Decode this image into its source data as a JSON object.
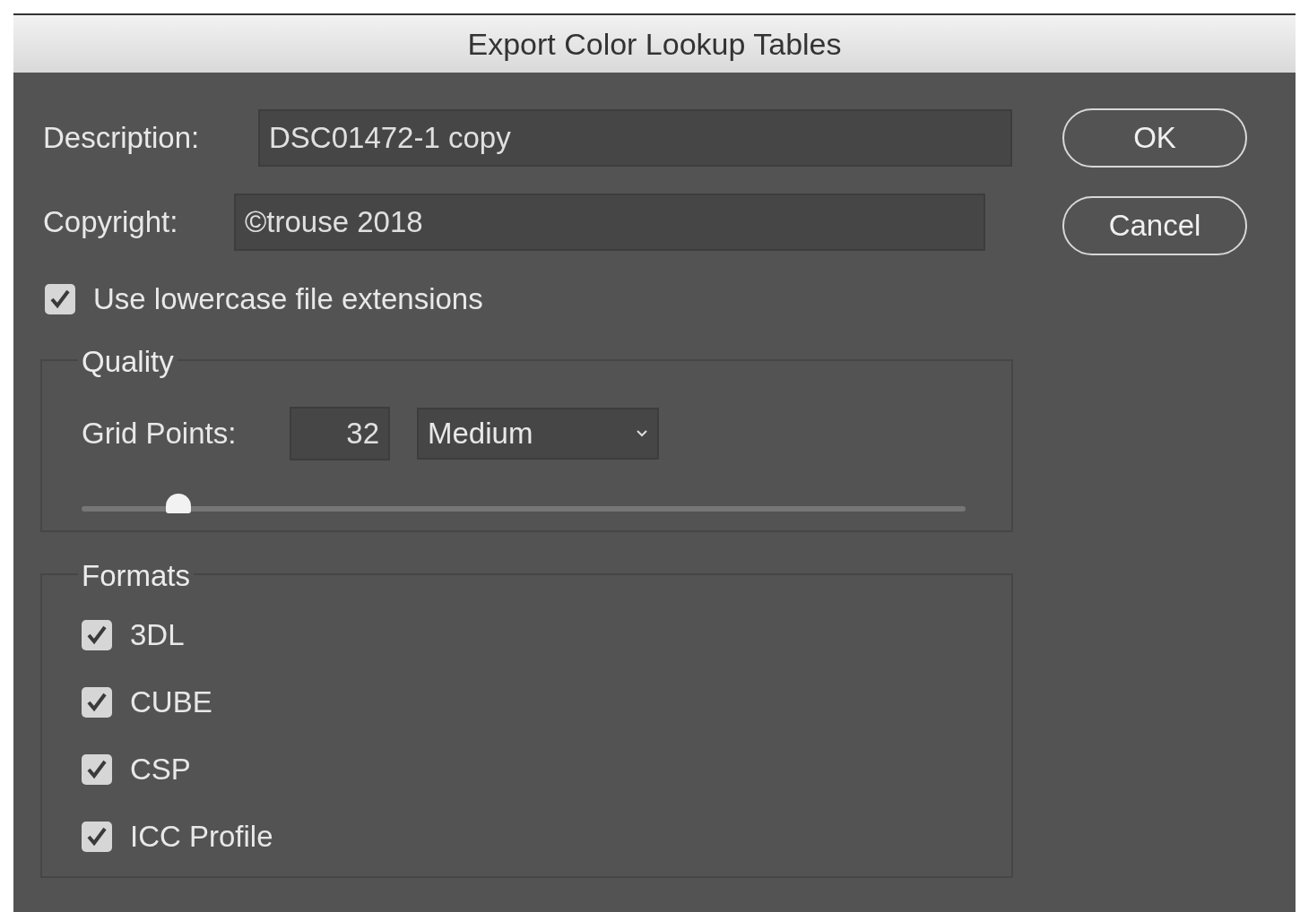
{
  "window": {
    "title": "Export Color Lookup Tables"
  },
  "description": {
    "label": "Description:",
    "value": "DSC01472-1 copy"
  },
  "copyright": {
    "label": "Copyright:",
    "value": "©trouse 2018"
  },
  "lowercase": {
    "label": "Use lowercase file extensions",
    "checked": true
  },
  "quality": {
    "legend": "Quality",
    "grid_label": "Grid Points:",
    "grid_value": "32",
    "preset": "Medium",
    "level": 0.11
  },
  "formats": {
    "legend": "Formats",
    "items": [
      {
        "label": "3DL",
        "checked": true
      },
      {
        "label": "CUBE",
        "checked": true
      },
      {
        "label": "CSP",
        "checked": true
      },
      {
        "label": "ICC Profile",
        "checked": true
      }
    ]
  },
  "buttons": [
    {
      "label": "OK"
    },
    {
      "label": "Cancel"
    }
  ]
}
